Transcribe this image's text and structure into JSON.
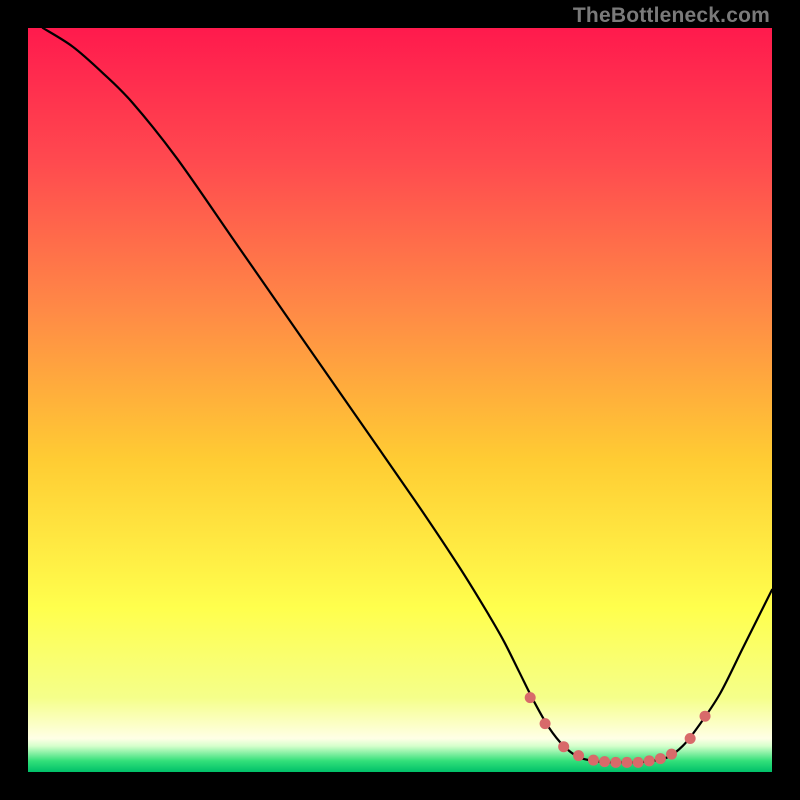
{
  "watermark": "TheBottleneck.com",
  "chart_data": {
    "type": "line",
    "title": "",
    "xlabel": "",
    "ylabel": "",
    "xlim": [
      0,
      100
    ],
    "ylim": [
      0,
      100
    ],
    "background_gradient": {
      "type": "vertical",
      "stops": [
        {
          "offset": 0.0,
          "color": "#ff1a4d"
        },
        {
          "offset": 0.18,
          "color": "#ff4a4f"
        },
        {
          "offset": 0.38,
          "color": "#ff8a46"
        },
        {
          "offset": 0.58,
          "color": "#ffcc33"
        },
        {
          "offset": 0.78,
          "color": "#ffff4d"
        },
        {
          "offset": 0.9,
          "color": "#f5ff8a"
        },
        {
          "offset": 0.955,
          "color": "#ffffe6"
        },
        {
          "offset": 0.965,
          "color": "#d6ffcc"
        },
        {
          "offset": 0.985,
          "color": "#33e07a"
        },
        {
          "offset": 1.0,
          "color": "#00c069"
        }
      ]
    },
    "series": [
      {
        "name": "bottleneck-curve",
        "color": "#000000",
        "x": [
          2,
          6,
          10,
          14,
          20,
          28,
          36,
          44,
          52,
          58,
          62,
          64,
          66,
          68,
          70,
          72,
          74,
          76,
          78,
          80,
          82,
          84,
          86,
          88,
          90,
          93,
          96,
          98,
          100
        ],
        "y": [
          100,
          97.5,
          94,
          90,
          82.5,
          71,
          59.5,
          48,
          36.5,
          27.5,
          21,
          17.5,
          13.5,
          9.5,
          6.0,
          3.5,
          2.0,
          1.5,
          1.3,
          1.3,
          1.3,
          1.5,
          2.0,
          3.5,
          6.0,
          10.5,
          16.5,
          20.5,
          24.5
        ]
      }
    ],
    "markers": {
      "name": "optimal-range-dots",
      "color": "#d86a6a",
      "radius": 5.5,
      "x": [
        67.5,
        69.5,
        72.0,
        74.0,
        76.0,
        77.5,
        79.0,
        80.5,
        82.0,
        83.5,
        85.0,
        86.5,
        89.0,
        91.0
      ],
      "y": [
        10.0,
        6.5,
        3.4,
        2.2,
        1.6,
        1.4,
        1.3,
        1.3,
        1.3,
        1.5,
        1.8,
        2.4,
        4.5,
        7.5
      ]
    }
  }
}
